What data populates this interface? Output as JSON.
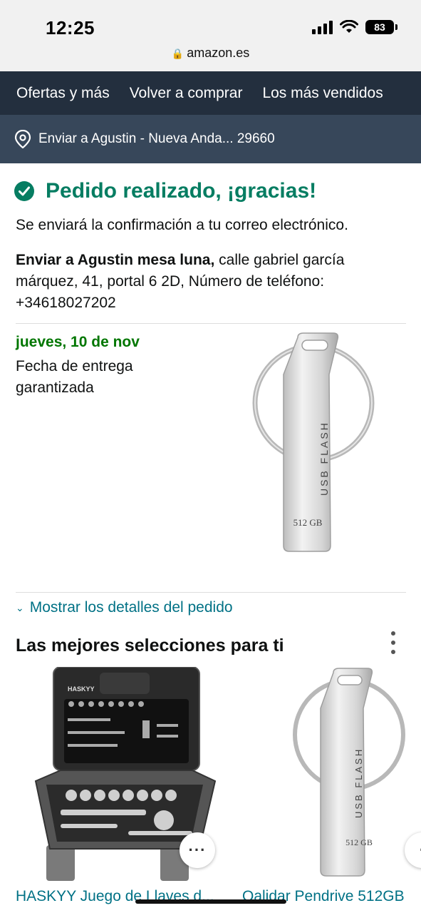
{
  "status_bar": {
    "time": "12:25",
    "battery": "83",
    "url": "amazon.es"
  },
  "nav": {
    "items": [
      "Ofertas y más",
      "Volver a comprar",
      "Los más vendidos"
    ]
  },
  "delivery": {
    "text": "Enviar a Agustin - Nueva Anda... 29660"
  },
  "confirmation": {
    "title": "Pedido realizado, ¡gracias!",
    "message": "Se enviará la confirmación a tu correo electrónico.",
    "ship_to_name": "Enviar a Agustin mesa luna,",
    "ship_to_address": " calle gabriel garcía márquez, 41, portal 6 2D, Número de teléfono: +34618027202",
    "delivery_date": "jueves, 10 de nov",
    "delivery_label": "Fecha de entrega garantizada",
    "product_capacity": "512 GB",
    "product_marking": "USB FLASH"
  },
  "details_link": "Mostrar los detalles del pedido",
  "recommendations": {
    "title": "Las mejores selecciones para ti",
    "brand_mark": "HASKYY",
    "items": [
      {
        "title": "HASKYY Juego de Llaves d..."
      },
      {
        "title": "Qalidar Pendrive 512GB",
        "capacity": "512 GB",
        "marking": "USB FLASH"
      }
    ]
  },
  "colors": {
    "nav_bg": "#232f3e",
    "delivery_bg": "#37475a",
    "success_green": "#067d62",
    "date_green": "#007600",
    "link_teal": "#007185"
  }
}
